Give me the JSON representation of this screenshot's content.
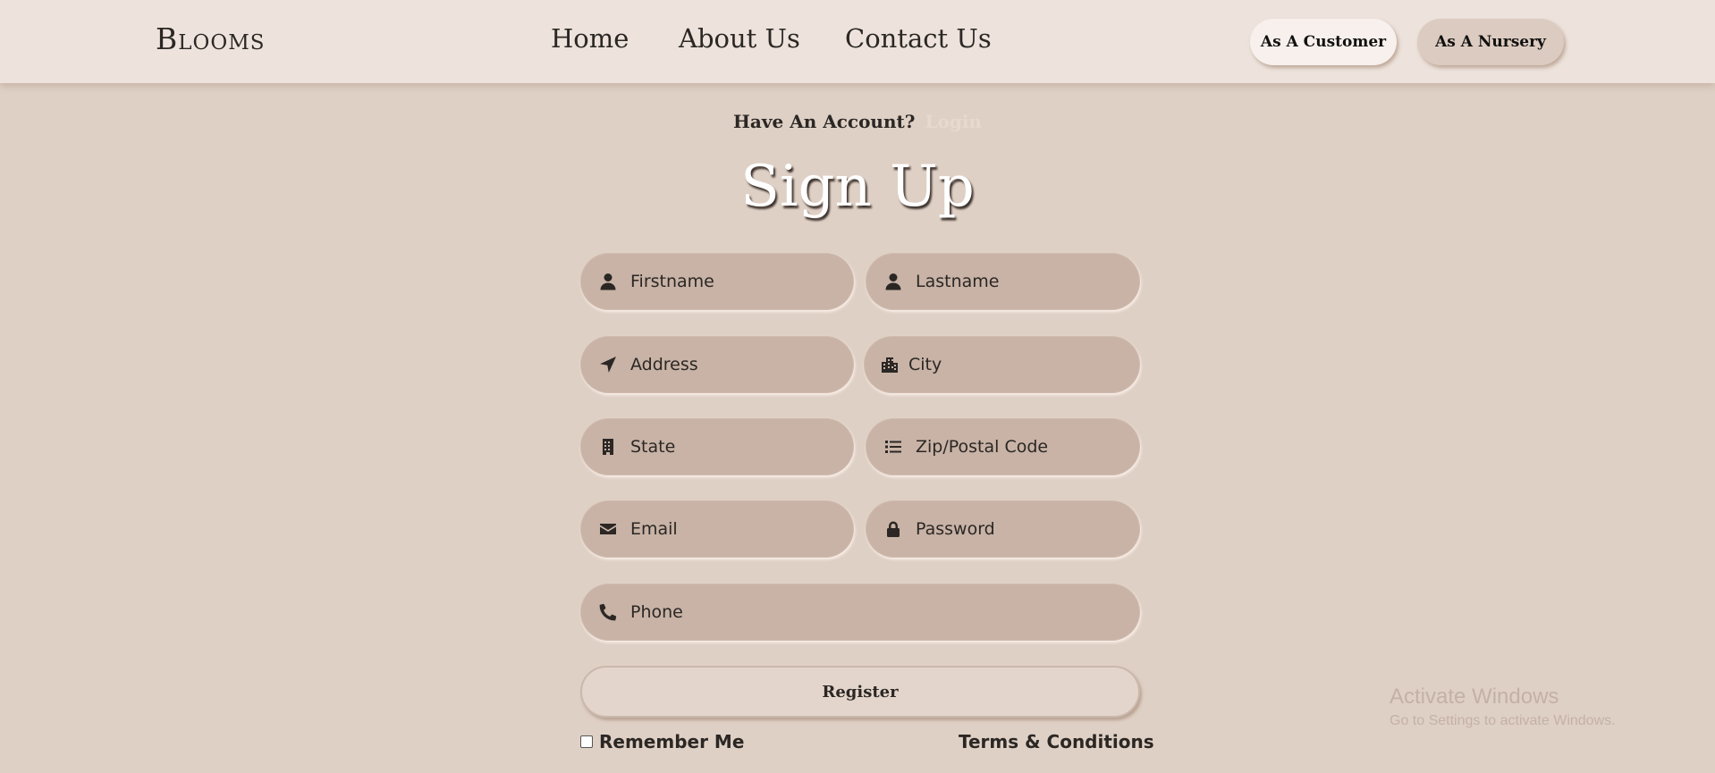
{
  "header": {
    "logo": "Blooms",
    "nav": [
      {
        "label": "Home"
      },
      {
        "label": "About Us"
      },
      {
        "label": "Contact Us"
      }
    ],
    "buttons": {
      "customer": "As A Customer",
      "nursery": "As A Nursery"
    }
  },
  "signup": {
    "have_account": "Have An Account?",
    "login_link": "Login",
    "title": "Sign Up",
    "fields": {
      "firstname": {
        "placeholder": "Firstname",
        "icon": "user-icon"
      },
      "lastname": {
        "placeholder": "Lastname",
        "icon": "user-icon"
      },
      "address": {
        "placeholder": "Address",
        "icon": "location-arrow-icon"
      },
      "city": {
        "placeholder": "City",
        "icon": "city-icon"
      },
      "state": {
        "placeholder": "State",
        "icon": "building-icon"
      },
      "zip": {
        "placeholder": "Zip/Postal Code",
        "icon": "list-icon"
      },
      "email": {
        "placeholder": "Email",
        "icon": "envelope-icon"
      },
      "password": {
        "placeholder": "Password",
        "icon": "lock-icon"
      },
      "phone": {
        "placeholder": "Phone",
        "icon": "phone-icon"
      }
    },
    "register_label": "Register",
    "remember_label": "Remember Me",
    "remember_checked": false,
    "terms_label": "Terms & Conditions"
  },
  "watermark": {
    "line1": "Activate Windows",
    "line2": "Go to Settings to activate Windows."
  },
  "colors": {
    "background": "#dfd0c5",
    "header": "#ede3dc",
    "field": "#c8b3a6",
    "text": "#2b2724",
    "login_link": "#e8d9cf"
  }
}
